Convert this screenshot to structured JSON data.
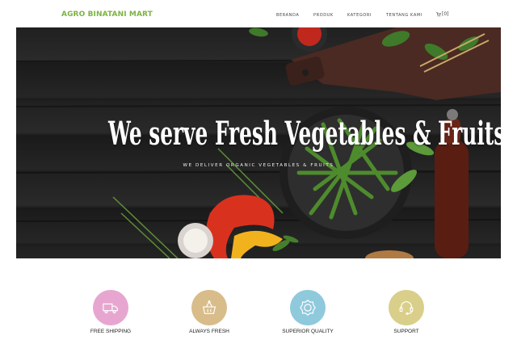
{
  "nav": {
    "brand": "AGRO BINATANI MART",
    "items": [
      "BERANDA",
      "PRODUK",
      "KATEGORI",
      "TENTANG KAMI"
    ],
    "cart_count": "[0]"
  },
  "hero": {
    "title": "We serve Fresh Vegetables & Fruits",
    "subtitle": "WE DELIVER ORGANIC VEGETABLES & FRUITS"
  },
  "features": [
    {
      "label": "FREE SHIPPING",
      "icon": "truck-icon",
      "color": "#e7a6d0"
    },
    {
      "label": "ALWAYS FRESH",
      "icon": "fresh-basket-icon",
      "color": "#d8bc8a"
    },
    {
      "label": "SUPERIOR QUALITY",
      "icon": "quality-badge-icon",
      "color": "#8fc9dc"
    },
    {
      "label": "SUPPORT",
      "icon": "support-headset-icon",
      "color": "#d9cf8a"
    }
  ],
  "colors": {
    "brand": "#7cb342",
    "nav_text": "#444444",
    "hero_bg": "#232323"
  }
}
